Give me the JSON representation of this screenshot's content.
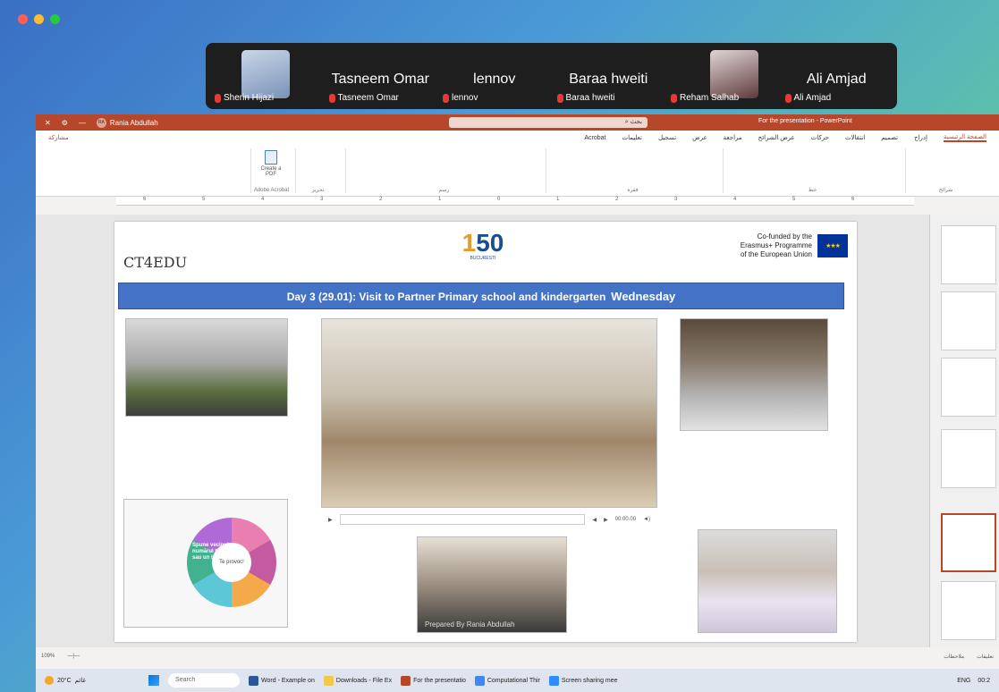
{
  "meeting": {
    "tiles": [
      {
        "big": "",
        "tag": "Sherin Hijazi",
        "has_avatar": true
      },
      {
        "big": "Tasneem Omar",
        "tag": "Tasneem Omar"
      },
      {
        "big": "lennov",
        "tag": "lennov"
      },
      {
        "big": "Baraa hweiti",
        "tag": "Baraa hweiti"
      },
      {
        "big": "",
        "tag": "Reham Salhab",
        "has_avatar": true
      },
      {
        "big": "Ali Amjad",
        "tag": "Ali Amjad"
      }
    ]
  },
  "ppt": {
    "user": "Rania Abdullah",
    "user_initials": "RA",
    "search_placeholder": "بحث",
    "doc_title": "For the presentation - PowerPoint",
    "menu": [
      "الصفحة الرئيسية",
      "إدراج",
      "تصميم",
      "انتقالات",
      "حركات",
      "عرض الشرائح",
      "مراجعة",
      "عرض",
      "تسجيل",
      "تعليمات",
      "Acrobat"
    ],
    "share": "مشاركة",
    "ribbon": {
      "create_pdf": "Create a PDF",
      "adobe_acrobat": "Adobe Acrobat",
      "editing": "تحرير",
      "drawing": "رسم",
      "paragraph": "فقرة",
      "font": "خط",
      "slides": "شرائح"
    },
    "ruler": [
      "6",
      "5",
      "4",
      "3",
      "2",
      "1",
      "0",
      "1",
      "2",
      "3",
      "4",
      "5",
      "6"
    ],
    "status": {
      "zoom": "109%",
      "notes": "ملاحظات",
      "comments": "تعليقات"
    }
  },
  "slide": {
    "logo_left": "CT4EDU",
    "logo_center_num": "1",
    "logo_center_num2": "50",
    "logo_center_sub": "BUCURESTI",
    "eu_line1": "Co-funded by the",
    "eu_line2": "Erasmus+ Programme",
    "eu_line3": "of the European Union",
    "banner": "Day 3 (29.01): Visit to Partner Primary school and kindergarten",
    "banner_day": "Wednesday",
    "wheel_text": "Spune vecinul numărul tău sau un lucru",
    "wheel_center": "Te provoc!",
    "video_time": "00:00.00",
    "watermark": "Prepared By Rania Abdullah"
  },
  "taskbar": {
    "temp": "20°C",
    "weather_label": "غائم",
    "search": "Search",
    "apps": [
      {
        "label": "Word - Example on",
        "color": "#2b579a"
      },
      {
        "label": "Downloads - File Ex",
        "color": "#f2c94c"
      },
      {
        "label": "For the presentatio",
        "color": "#b7472a"
      },
      {
        "label": "Computational Thir",
        "color": "#4285f4"
      },
      {
        "label": "Screen sharing mee",
        "color": "#2d8cff"
      }
    ],
    "lang": "ENG",
    "time": "00:2"
  },
  "colors": {
    "ppt_accent": "#b7472a",
    "banner": "#4472c4",
    "desktop_start": "#3a6fc4",
    "desktop_end": "#6fd08c"
  }
}
